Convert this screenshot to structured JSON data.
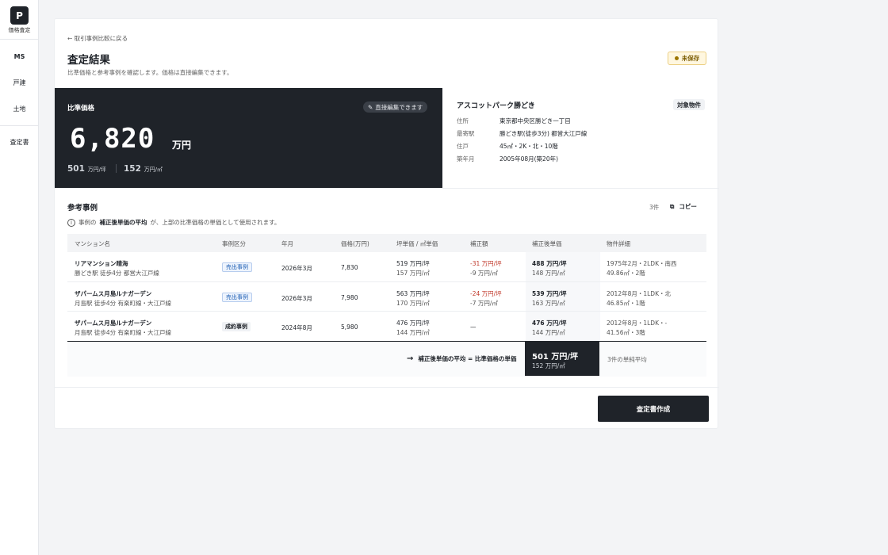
{
  "sidebar": {
    "logo": "P",
    "logo_caption": "価格査定",
    "items": [
      {
        "label": "MS"
      },
      {
        "label": "戸建"
      },
      {
        "label": "土地"
      },
      {
        "label": "査定書"
      }
    ]
  },
  "header": {
    "back_link": "← 取引事例比較に戻る",
    "title": "査定結果",
    "subtitle": "比準価格と参考事例を確認します。価格は直接編集できます。",
    "status_badge": "未保存"
  },
  "price": {
    "label": "比準価格",
    "edit_pill": "直接編集できます",
    "value": "6,820",
    "unit": "万円",
    "tsubo_value": "501",
    "tsubo_unit": "万円/坪",
    "sqm_value": "152",
    "sqm_unit": "万円/㎡"
  },
  "property": {
    "name": "アスコットパーク勝どき",
    "tag": "対象物件",
    "fields": [
      {
        "key": "住所",
        "value": "東京都中央区勝どき一丁目"
      },
      {
        "key": "最寄駅",
        "value": "勝どき駅(徒歩3分) 都営大江戸線"
      },
      {
        "key": "住戸",
        "value": "45㎡・2K・北・10階"
      },
      {
        "key": "築年月",
        "value": "2005年08月(築20年)"
      }
    ]
  },
  "references": {
    "title": "参考事例",
    "count": "3件",
    "copy_label": "コピー",
    "note_pre": "事例の",
    "note_bold": "補正後単価の平均",
    "note_post": "が、上部の比準価格の単価として使用されます。",
    "columns": [
      "マンション名",
      "事例区分",
      "年月",
      "価格(万円)",
      "坪単価 / ㎡単価",
      "補正額",
      "補正後単価",
      "物件詳細"
    ],
    "rows": [
      {
        "name": "リアマンション晴海",
        "station": "勝どき駅 徒歩4分 都営大江戸線",
        "type": "売出事例",
        "date": "2026年3月",
        "price": "7,830",
        "unit1": "519 万円/坪",
        "unit2": "157 万円/㎡",
        "adj1": "-31 万円/坪",
        "adj2": "-9 万円/㎡",
        "cor1": "488 万円/坪",
        "cor2": "148 万円/㎡",
        "det1": "1975年2月・2LDK・南西",
        "det2": "49.86㎡・2階"
      },
      {
        "name": "ザパームス月島ルナガーデン",
        "station": "月島駅 徒歩4分 有楽町線・大江戸線",
        "type": "売出事例",
        "date": "2026年3月",
        "price": "7,980",
        "unit1": "563 万円/坪",
        "unit2": "170 万円/㎡",
        "adj1": "-24 万円/坪",
        "adj2": "-7 万円/㎡",
        "cor1": "539 万円/坪",
        "cor2": "163 万円/㎡",
        "det1": "2012年8月・1LDK・北",
        "det2": "46.85㎡・1階"
      },
      {
        "name": "ザパームス月島ルナガーデン",
        "station": "月島駅 徒歩4分 有楽町線・大江戸線",
        "type": "成約事例",
        "date": "2024年8月",
        "price": "5,980",
        "unit1": "476 万円/坪",
        "unit2": "144 万円/㎡",
        "adj1": "—",
        "adj2": "",
        "cor1": "476 万円/坪",
        "cor2": "144 万円/㎡",
        "det1": "2012年8月・1LDK・-",
        "det2": "41.56㎡・3階"
      }
    ],
    "footer_label": "補正後単価の平均 = 比準価格の単価",
    "footer_val1": "501 万円/坪",
    "footer_val2": "152 万円/㎡",
    "footer_note": "3件の単純平均"
  },
  "action": {
    "create_report": "査定書作成"
  },
  "colors": {
    "dark": "#1f2329",
    "accent_warning": "#eccf83",
    "negative": "#c0392b",
    "tag_blue": "#2060b5"
  }
}
